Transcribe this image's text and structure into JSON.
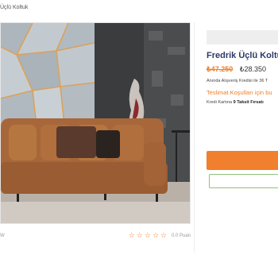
{
  "breadcrumb": {
    "last": "Üçlü Koltuk"
  },
  "product": {
    "title": "Fredrik Üçlü Koltu",
    "old_price": "₺47.250",
    "new_price": "₺28.350",
    "credit_note": "Anında Alışveriş Kredisi ile 36 T",
    "delivery_link": "Teslimat Koşulları için bu",
    "installment_prefix": "Kredi Kartına ",
    "installment_bold": "9 Taksit Fırsatı"
  },
  "reviews": {
    "left_text": "W",
    "stars": [
      "☆",
      "☆",
      "☆",
      "☆",
      "☆"
    ],
    "points": "0.0 Puan"
  },
  "colors": {
    "accent": "#f07f2e",
    "title": "#2b3a67",
    "fav_border": "#8ec27a"
  },
  "icons": {
    "star": "star-outline-icon"
  }
}
